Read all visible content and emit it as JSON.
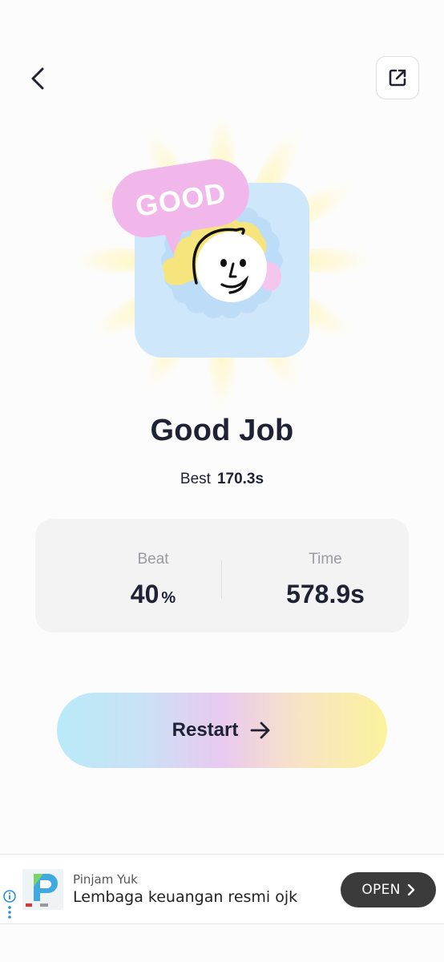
{
  "header": {
    "back_icon": "chevron-left-icon",
    "share_icon": "external-link-icon"
  },
  "hero": {
    "bubble_text": "GOOD",
    "colors": {
      "bubble": "#f2b7ea",
      "card": "#cfe7fb",
      "hair": "#f5e37a",
      "burst": "#fff6c2"
    }
  },
  "result": {
    "title": "Good Job",
    "best_label": "Best",
    "best_value": "170.3s"
  },
  "stats": {
    "beat": {
      "label": "Beat",
      "value": "40",
      "unit": "%"
    },
    "time": {
      "label": "Time",
      "value": "578.9s"
    }
  },
  "restart": {
    "label": "Restart",
    "icon": "arrow-right-icon"
  },
  "ad": {
    "info_icon": "info-icon",
    "advertiser": "Pinjam Yuk",
    "headline": "Lembaga keuangan resmi ojk",
    "cta": "OPEN"
  }
}
